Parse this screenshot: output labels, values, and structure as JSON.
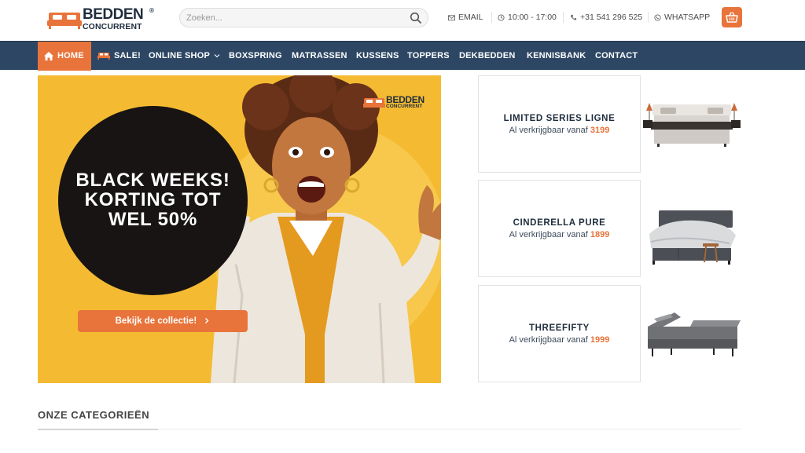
{
  "brand": {
    "name_line1": "BEDDEN",
    "name_line2": "CONCURRENT",
    "registered": "®",
    "accent_color": "#e8743b",
    "nav_color": "#2c4663"
  },
  "header": {
    "search_placeholder": "Zoeken...",
    "email_label": "EMAIL",
    "hours": "10:00 - 17:00",
    "phone": "+31 541 296 525",
    "whatsapp_label": "WHATSAPP",
    "icons": [
      "search-icon",
      "mail-icon",
      "clock-icon",
      "phone-icon",
      "whatsapp-icon",
      "basket-icon"
    ]
  },
  "nav": {
    "items": [
      {
        "label": "HOME",
        "icon": "home-icon",
        "active": true
      },
      {
        "label": "SALE!",
        "icon": "bed-icon"
      },
      {
        "label": "ONLINE SHOP",
        "icon": "chevron-down-icon"
      },
      {
        "label": "BOXSPRING"
      },
      {
        "label": "MATRASSEN"
      },
      {
        "label": "KUSSENS"
      },
      {
        "label": "TOPPERS"
      },
      {
        "label": "DEKBEDDEN"
      },
      {
        "label": "KENNISBANK"
      },
      {
        "label": "CONTACT"
      }
    ]
  },
  "hero": {
    "line1": "BLACK WEEKS!",
    "line2": "KORTING TOT",
    "line3": "WEL 50%",
    "cta_label": "Bekijk de collectie!",
    "cta_icon": "chevron-right-icon",
    "logo_line1": "BEDDEN",
    "logo_line2": "CONCURRENT"
  },
  "products": [
    {
      "title": "LIMITED SERIES LIGNE",
      "prefix": "Al verkrijgbaar vanaf",
      "price": "3199"
    },
    {
      "title": "CINDERELLA PURE",
      "prefix": "Al verkrijgbaar vanaf",
      "price": "1899"
    },
    {
      "title": "THREEFIFTY",
      "prefix": "Al verkrijgbaar vanaf",
      "price": "1999"
    }
  ],
  "categories": {
    "title": "ONZE CATEGORIEËN"
  }
}
